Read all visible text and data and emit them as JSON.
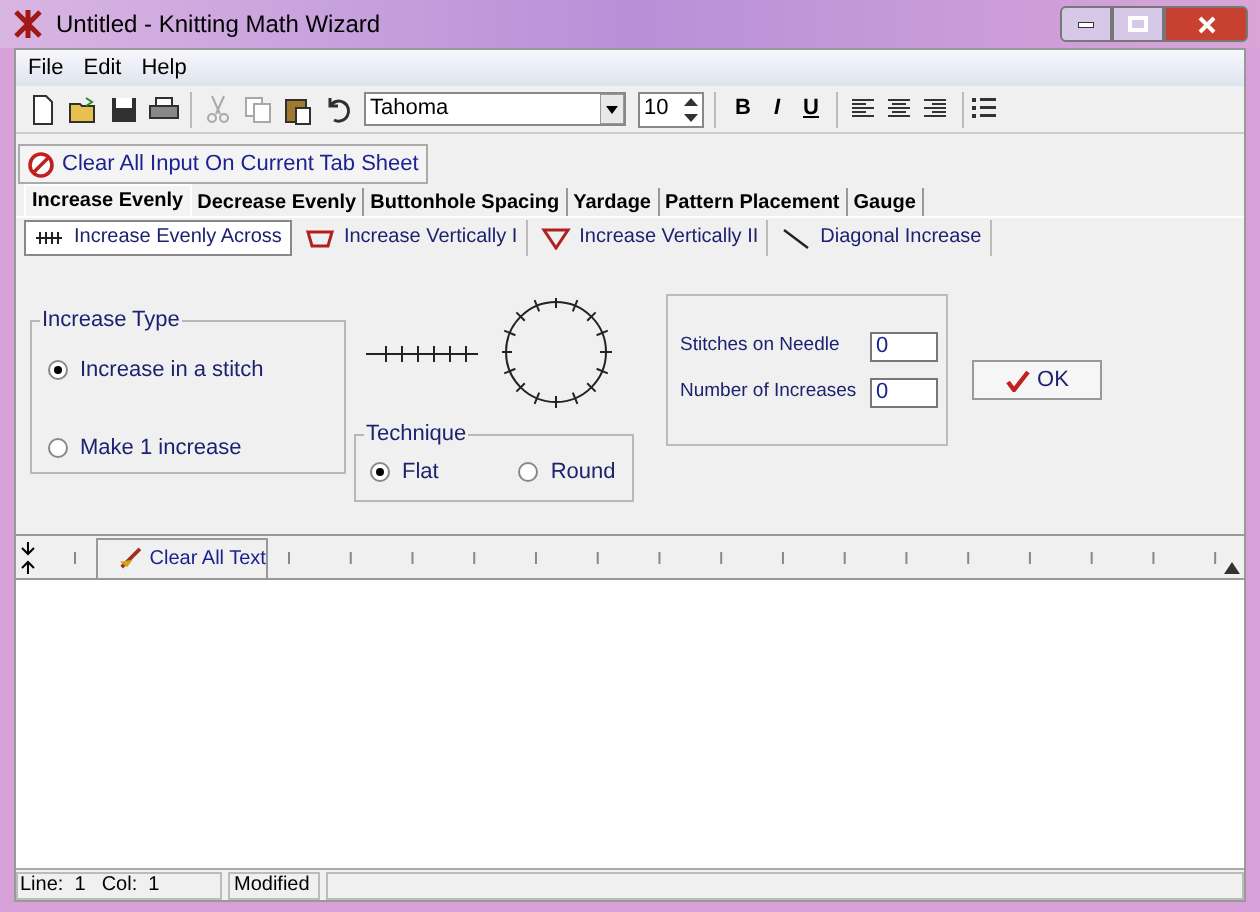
{
  "window": {
    "title": "Untitled - Knitting Math Wizard"
  },
  "menu": [
    "File",
    "Edit",
    "Help"
  ],
  "tools": [
    {
      "kind": "new",
      "disabled": false
    },
    {
      "kind": "open",
      "disabled": false
    },
    {
      "kind": "save",
      "disabled": false
    },
    {
      "kind": "print",
      "disabled": false
    },
    {
      "kind": "cut",
      "disabled": true
    },
    {
      "kind": "copy",
      "disabled": true
    },
    {
      "kind": "paste",
      "disabled": false
    },
    {
      "kind": "undo",
      "disabled": false
    }
  ],
  "font_box": {
    "value": "Tahoma"
  },
  "size_box": {
    "value": "10"
  },
  "format_buttons": [
    "B",
    "I",
    "U"
  ],
  "clear_tab_button": "Clear All Input On Current Tab Sheet",
  "tabs": [
    {
      "label": "Increase Evenly",
      "selected": true
    },
    {
      "label": "Decrease Evenly",
      "selected": false
    },
    {
      "label": "Buttonhole Spacing",
      "selected": false
    },
    {
      "label": "Yardage",
      "selected": false
    },
    {
      "label": "Pattern Placement",
      "selected": false
    },
    {
      "label": "Gauge",
      "selected": false
    }
  ],
  "subtabs": [
    {
      "label": "Increase Evenly Across",
      "selected": true
    },
    {
      "label": "Increase Vertically I",
      "selected": false
    },
    {
      "label": "Increase Vertically II",
      "selected": false
    },
    {
      "label": "Diagonal Increase",
      "selected": false
    }
  ],
  "increase_type": {
    "title": "Increase Type",
    "options": [
      {
        "label": "Increase in a stitch",
        "selected": true
      },
      {
        "label": "Make 1 increase",
        "selected": false
      }
    ]
  },
  "technique": {
    "title": "Technique",
    "options": [
      {
        "label": "Flat",
        "selected": true
      },
      {
        "label": "Round",
        "selected": false
      }
    ]
  },
  "fields": [
    {
      "label": "Stitches on Needle",
      "value": "0"
    },
    {
      "label": "Number of Increases",
      "value": "0"
    }
  ],
  "ok_button": "OK",
  "clear_text_button": "Clear All Text",
  "status_bar": {
    "line": "Line:  1",
    "col": "Col:  1",
    "state": "Modified"
  }
}
